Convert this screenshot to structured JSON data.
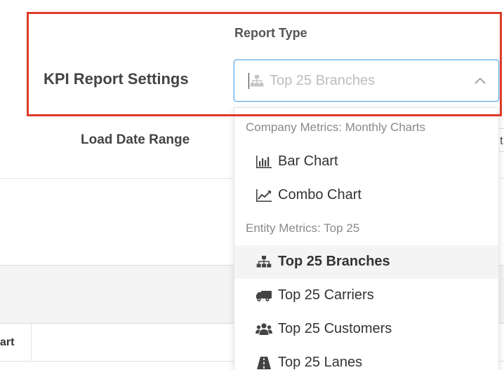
{
  "settings": {
    "title": "KPI Report Settings",
    "report_type_label": "Report Type",
    "load_date_label": "Load Date Range"
  },
  "report_type_select": {
    "value": "Top 25 Branches",
    "icon": "sitemap-icon"
  },
  "dropdown": {
    "groups": [
      {
        "label": "Company Metrics: Monthly Charts",
        "options": [
          {
            "label": "Bar Chart",
            "icon": "bar-chart-icon",
            "selected": false
          },
          {
            "label": "Combo Chart",
            "icon": "line-chart-icon",
            "selected": false
          }
        ]
      },
      {
        "label": "Entity Metrics: Top 25",
        "options": [
          {
            "label": "Top 25 Branches",
            "icon": "sitemap-icon",
            "selected": true
          },
          {
            "label": "Top 25 Carriers",
            "icon": "truck-icon",
            "selected": false
          },
          {
            "label": "Top 25 Customers",
            "icon": "users-icon",
            "selected": false
          },
          {
            "label": "Top 25 Lanes",
            "icon": "road-icon",
            "selected": false
          }
        ]
      }
    ]
  },
  "background": {
    "table_column_partial": "art",
    "right_input_partial": "t"
  },
  "colors": {
    "highlight": "#dd3b2a",
    "focus_border": "#5aa7e6",
    "selected_row": "#f4f4f4"
  }
}
